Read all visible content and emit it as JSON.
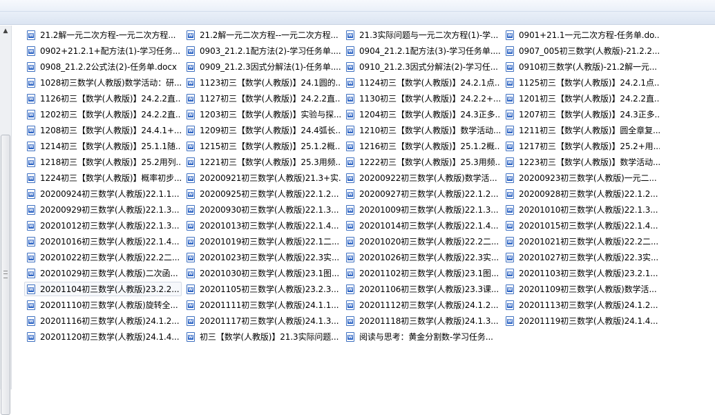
{
  "files": [
    "21.2解一元二次方程-一元二次方程...",
    "21.2解一元二次方程--一元二次方程...",
    "21.3实际问题与一元二次方程(1)-学...",
    "0901+21.1一元二次方程-任务单.do...",
    "0902+21.2.1+配方法(1)-学习任务...",
    "0903_21.2.1配方法(2)-学习任务单....",
    "0904_21.2.1配方法(3)-学习任务单....",
    "0907_005初三数学(人教版)-21.2.2...",
    "0908_21.2.2公式法(2)-任务单.docx",
    "0909_21.2.3因式分解法(1)-任务单....",
    "0910_21.2.3因式分解法(2)-学习任...",
    "0910初三数学(人教版)-21.2解一元...",
    "1028初三数学(人教版)数学活动：研...",
    "1123初三【数学(人教版)】24.1圆的...",
    "1124初三【数学(人教版)】24.2.1点...",
    "1125初三【数学(人教版)】24.2.1点...",
    "1126初三【数学(人教版)】24.2.2直...",
    "1127初三【数学(人教版)】24.2.2直...",
    "1130初三【数学(人教版)】24.2.2+...",
    "1201初三【数学(人教版)】24.2.2直...",
    "1202初三【数学(人教版)】24.2.2直...",
    "1203初三【数学(人教版)】实验与探...",
    "1204初三【数学(人教版)】24.3正多...",
    "1207初三【数学(人教版)】24.3正多...",
    "1208初三【数学(人教版)】24.4.1+...",
    "1209初三【数学(人教版)】24.4弧长...",
    "1210初三【数学(人教版)】数学活动...",
    "1211初三【数学(人教版)】圆全章复...",
    "1214初三【数学(人教版)】25.1.1随...",
    "1215初三【数学(人教版)】25.1.2概...",
    "1216初三【数学(人教版)】25.1.2概...",
    "1217初三【数学(人教版)】25.2+用...",
    "1218初三【数学(人教版)】25.2用列...",
    "1221初三【数学(人教版)】25.3用频...",
    "1222初三【数学(人教版)】25.3用频...",
    "1223初三【数学(人教版)】数学活动...",
    "1224初三【数学(人教版)】概率初步...",
    "20200921初三数学(人教版)21.3+实...",
    "20200922初三数学(人教版)数学活...",
    "20200923初三数学(人教版)一元二...",
    "20200924初三数学(人教版)22.1.1...",
    "20200925初三数学(人教版)22.1.2...",
    "20200927初三数学(人教版)22.1.2...",
    "20200928初三数学(人教版)22.1.2...",
    "20200929初三数学(人教版)22.1.3...",
    "20200930初三数学(人教版)22.1.3...",
    "20201009初三数学(人教版)22.1.3...",
    "20201010初三数学(人教版)22.1.3...",
    "20201012初三数学(人教版)22.1.3...",
    "20201013初三数学(人教版)22.1.4...",
    "20201014初三数学(人教版)22.1.4...",
    "20201015初三数学(人教版)22.1.4...",
    "20201016初三数学(人教版)22.1.4...",
    "20201019初三数学(人教版)22.1二...",
    "20201020初三数学(人教版)22.2二...",
    "20201021初三数学(人教版)22.2二...",
    "20201022初三数学(人教版)22.2二...",
    "20201023初三数学(人教版)22.3实...",
    "20201026初三数学(人教版)22.3实...",
    "20201027初三数学(人教版)22.3实...",
    "20201029初三数学(人教版)二次函...",
    "20201030初三数学(人教版)23.1图...",
    "20201102初三数学(人教版)23.1图...",
    "20201103初三数学(人教版)23.2.1...",
    "20201104初三数学(人教版)23.2.2...",
    "20201105初三数学(人教版)23.2.3...",
    "20201106初三数学(人教版)23.3课...",
    "20201109初三数学(人教版)数学活...",
    "20201110初三数学(人教版)旋转全...",
    "20201111初三数学(人教版)24.1.1...",
    "20201112初三数学(人教版)24.1.2...",
    "20201113初三数学(人教版)24.1.2...",
    "20201116初三数学(人教版)24.1.2...",
    "20201117初三数学(人教版)24.1.3...",
    "20201118初三数学(人教版)24.1.3...",
    "20201119初三数学(人教版)24.1.4...",
    "20201120初三数学(人教版)24.1.4...",
    "初三【数学(人教版)】21.3实际问题...",
    "阅读与思考：黄金分割数-学习任务..."
  ],
  "selected_index": 64,
  "icon": "word-document-icon",
  "colors": {
    "icon_blue": "#2b63c4",
    "selection_border": "#d5dbe5"
  }
}
